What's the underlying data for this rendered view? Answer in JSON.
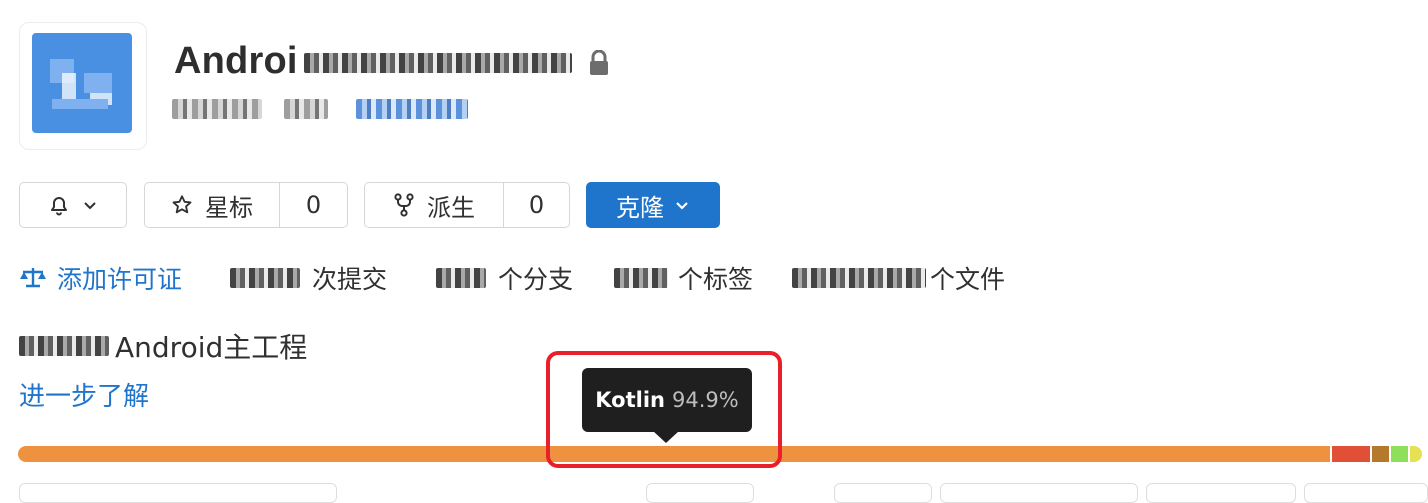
{
  "project": {
    "title": "Androi",
    "description_suffix": "Android主工程",
    "learn_more": "进一步了解"
  },
  "actions": {
    "star_label": "星标",
    "star_count": "0",
    "fork_label": "派生",
    "fork_count": "0",
    "clone_label": "克隆"
  },
  "stats": {
    "add_license": "添加许可证",
    "commits_suffix": "次提交",
    "branches_suffix": "个分支",
    "tags_suffix": "个标签",
    "files_suffix": "个文件"
  },
  "tooltip": {
    "language": "Kotlin",
    "percent": "94.9%"
  },
  "languages": [
    {
      "color": "#ee9240",
      "share": 94.9
    },
    {
      "color": "#e24f37",
      "share": 2.8
    },
    {
      "color": "#b5792b",
      "share": 1.2
    },
    {
      "color": "#8ee05a",
      "share": 1.2
    },
    {
      "color": "#e6e054",
      "share": 0.9
    }
  ],
  "colors": {
    "accent": "#1f75cb",
    "highlight": "#e8202a"
  },
  "icons": {
    "lock": "lock-icon",
    "bell": "bell-icon",
    "star": "star-icon",
    "fork": "fork-icon",
    "chevron": "chevron-down-icon",
    "scale": "scale-icon"
  }
}
